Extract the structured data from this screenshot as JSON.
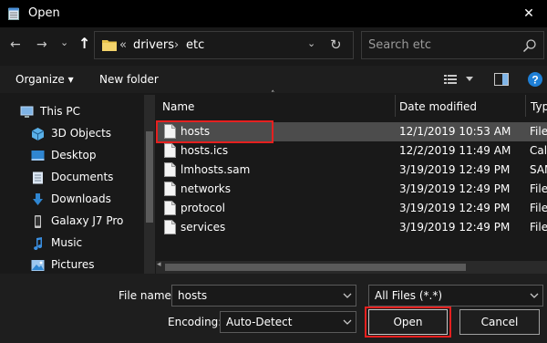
{
  "window": {
    "title": "Open",
    "close_symbol": "✕"
  },
  "nav": {
    "back_symbol": "←",
    "forward_symbol": "→",
    "recent_symbol": "⌄",
    "up_symbol": "↑",
    "breadcrumb": {
      "overflow": "«",
      "items": [
        "drivers",
        "etc"
      ],
      "separator": "›"
    },
    "refresh_symbol": "↻",
    "search_placeholder": "Search etc"
  },
  "toolbar": {
    "organize_label": "Organize ▾",
    "new_folder_label": "New folder"
  },
  "sidebar": {
    "items": [
      {
        "label": "This PC",
        "icon": "pc-icon"
      },
      {
        "label": "3D Objects",
        "icon": "cube-icon"
      },
      {
        "label": "Desktop",
        "icon": "desktop-icon"
      },
      {
        "label": "Documents",
        "icon": "documents-icon"
      },
      {
        "label": "Downloads",
        "icon": "download-icon"
      },
      {
        "label": "Galaxy J7 Pro",
        "icon": "phone-icon"
      },
      {
        "label": "Music",
        "icon": "music-icon"
      },
      {
        "label": "Pictures",
        "icon": "pictures-icon"
      }
    ]
  },
  "columns": {
    "name": "Name",
    "date": "Date modified",
    "type": "Type"
  },
  "files": [
    {
      "name": "hosts",
      "date": "12/1/2019 10:53 AM",
      "type": "File",
      "selected": true
    },
    {
      "name": "hosts.ics",
      "date": "12/2/2019 11:49 AM",
      "type": "Cal",
      "selected": false
    },
    {
      "name": "lmhosts.sam",
      "date": "3/19/2019 12:49 PM",
      "type": "SAM",
      "selected": false
    },
    {
      "name": "networks",
      "date": "3/19/2019 12:49 PM",
      "type": "File",
      "selected": false
    },
    {
      "name": "protocol",
      "date": "3/19/2019 12:49 PM",
      "type": "File",
      "selected": false
    },
    {
      "name": "services",
      "date": "3/19/2019 12:49 PM",
      "type": "File",
      "selected": false
    }
  ],
  "footer": {
    "file_name_label": "File name:",
    "file_name_value": "hosts",
    "file_type_value": "All Files  (*.*)",
    "encoding_label": "Encoding:",
    "encoding_value": "Auto-Detect",
    "open_label": "Open",
    "cancel_label": "Cancel"
  },
  "colors": {
    "accent": "#e5201f",
    "folder": "#e8c24a",
    "help": "#1e7fd6"
  }
}
